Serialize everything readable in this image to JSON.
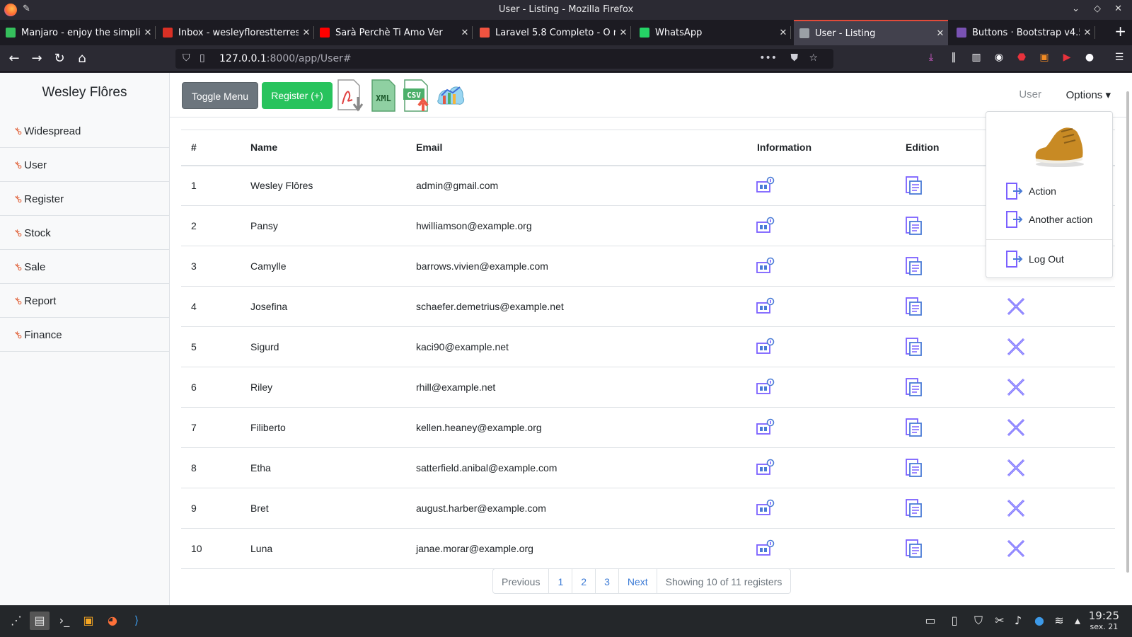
{
  "window": {
    "title": "User - Listing - Mozilla Firefox"
  },
  "tabs": [
    {
      "label": "Manjaro - enjoy the simpli",
      "favicon_color": "#35bf5c"
    },
    {
      "label": "Inbox - wesleyflorestterres",
      "favicon_color": "#d93025"
    },
    {
      "label": "Sarà Perchè Ti Amo Ver",
      "favicon_color": "#ff0000"
    },
    {
      "label": "Laravel 5.8 Completo - O n",
      "favicon_color": "#f05340"
    },
    {
      "label": "WhatsApp",
      "favicon_color": "#25d366"
    },
    {
      "label": "User - Listing",
      "favicon_color": "#9aa0a6"
    },
    {
      "label": "Buttons · Bootstrap v4.5",
      "favicon_color": "#7952b3"
    }
  ],
  "urlbar": {
    "host": "127.0.0.1",
    "rest": ":8000/app/User#"
  },
  "sidebar": {
    "brand": "Wesley Flôres",
    "items": [
      "Widespread",
      "User",
      "Register",
      "Stock",
      "Sale",
      "Report",
      "Finance"
    ]
  },
  "toolbar": {
    "toggle_label": "Toggle Menu",
    "register_label": "Register (+)",
    "xml_label": "XML",
    "csv_label": "CSV",
    "user_link": "User",
    "options_label": "Options ▾"
  },
  "table": {
    "headers": [
      "#",
      "Name",
      "Email",
      "Information",
      "Edition"
    ],
    "rows": [
      {
        "id": "1",
        "name": "Wesley Flôres",
        "email": "admin@gmail.com"
      },
      {
        "id": "2",
        "name": "Pansy",
        "email": "hwilliamson@example.org"
      },
      {
        "id": "3",
        "name": "Camylle",
        "email": "barrows.vivien@example.com"
      },
      {
        "id": "4",
        "name": "Josefina",
        "email": "schaefer.demetrius@example.net"
      },
      {
        "id": "5",
        "name": "Sigurd",
        "email": "kaci90@example.net"
      },
      {
        "id": "6",
        "name": "Riley",
        "email": "rhill@example.net"
      },
      {
        "id": "7",
        "name": "Filiberto",
        "email": "kellen.heaney@example.org"
      },
      {
        "id": "8",
        "name": "Etha",
        "email": "satterfield.anibal@example.com"
      },
      {
        "id": "9",
        "name": "Bret",
        "email": "august.harber@example.com"
      },
      {
        "id": "10",
        "name": "Luna",
        "email": "janae.morar@example.org"
      }
    ]
  },
  "pagination": {
    "previous": "Previous",
    "pages": [
      "1",
      "2",
      "3"
    ],
    "next": "Next",
    "summary": "Showing 10 of 11 registers"
  },
  "dropdown": {
    "items": [
      "Action",
      "Another action",
      "Log Out"
    ]
  },
  "taskbar": {
    "time": "19:25",
    "date": "sex. 21"
  },
  "colors": {
    "accent_green": "#28c35d",
    "icon_purple": "#7b61ff",
    "icon_blue": "#4a7bd6"
  }
}
